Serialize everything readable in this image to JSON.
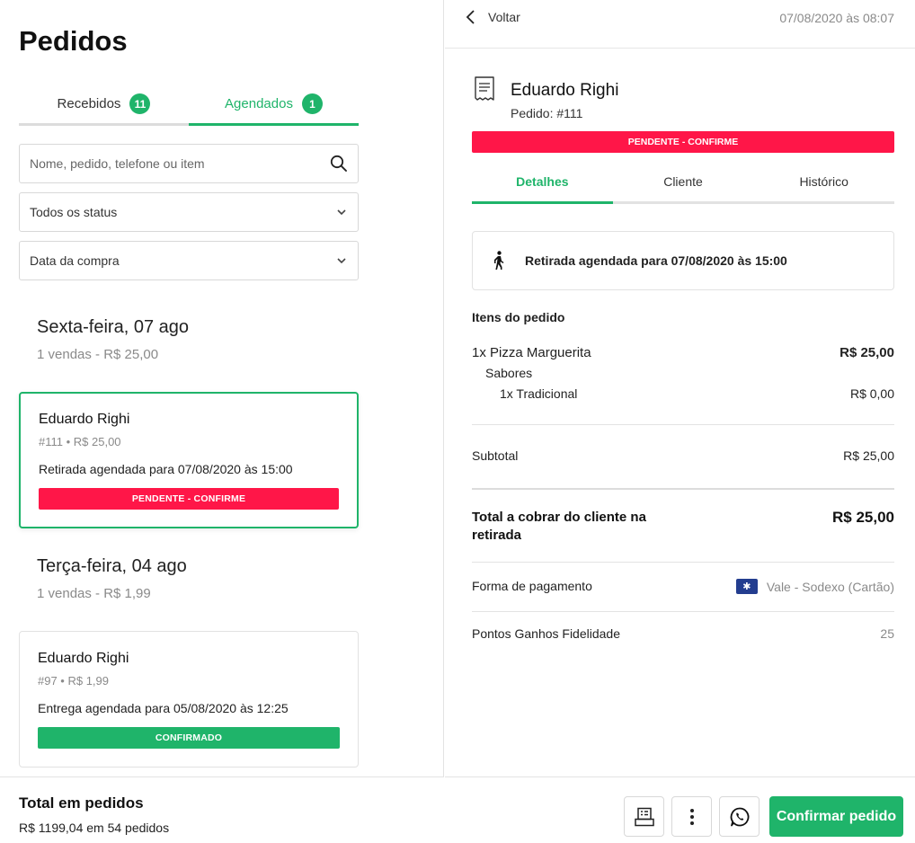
{
  "header": {
    "title": "Pedidos"
  },
  "tabs": [
    {
      "label": "Recebidos",
      "count": "11"
    },
    {
      "label": "Agendados",
      "count": "1"
    }
  ],
  "search": {
    "placeholder": "Nome, pedido, telefone ou item"
  },
  "filters": {
    "status": "Todos os status",
    "date": "Data da compra"
  },
  "groups": [
    {
      "day": "Sexta-feira, 07 ago",
      "summary": "1 vendas - R$ 25,00",
      "order": {
        "name": "Eduardo Righi",
        "meta": "#111 • R$ 25,00",
        "schedule": "Retirada agendada para 07/08/2020 às 15:00",
        "status": "PENDENTE - CONFIRME",
        "status_color": "#ff1648"
      }
    },
    {
      "day": "Terça-feira, 04 ago",
      "summary": "1 vendas - R$ 1,99",
      "order": {
        "name": "Eduardo Righi",
        "meta": "#97 • R$ 1,99",
        "schedule": "Entrega agendada para 05/08/2020 às 12:25",
        "status": "CONFIRMADO",
        "status_color": "#1fb46a"
      }
    }
  ],
  "footer": {
    "title": "Total em pedidos",
    "summary": "R$ 1199,04 em 54 pedidos"
  },
  "detail": {
    "back_label": "Voltar",
    "datetime": "07/08/2020 às 08:07",
    "customer": "Eduardo Righi",
    "order_number": "Pedido: #111",
    "status": "PENDENTE - CONFIRME",
    "tabs": [
      "Detalhes",
      "Cliente",
      "Histórico"
    ],
    "pickup": "Retirada agendada para 07/08/2020 às 15:00",
    "items_title": "Itens do pedido",
    "items": {
      "main": {
        "label": "1x Pizza Marguerita",
        "price": "R$ 25,00"
      },
      "group": "Sabores",
      "sub": {
        "label": "1x Tradicional",
        "price": "R$ 0,00"
      }
    },
    "subtotal": {
      "label": "Subtotal",
      "value": "R$ 25,00"
    },
    "total": {
      "label": "Total a cobrar do cliente na retirada",
      "value": "R$ 25,00"
    },
    "payment": {
      "label": "Forma de pagamento",
      "value": "Vale - Sodexo (Cartão)"
    },
    "points": {
      "label": "Pontos Ganhos Fidelidade",
      "value": "25"
    },
    "confirm_label": "Confirmar pedido"
  },
  "colors": {
    "accent": "#1fb46a",
    "pending": "#ff1648",
    "card_brand": "#233d8f"
  },
  "icons": [
    "search-icon",
    "chevron-down-icon",
    "chevron-left-icon",
    "receipt-icon",
    "walking-person-icon",
    "card-icon",
    "printer-icon",
    "more-vertical-icon",
    "whatsapp-icon"
  ]
}
